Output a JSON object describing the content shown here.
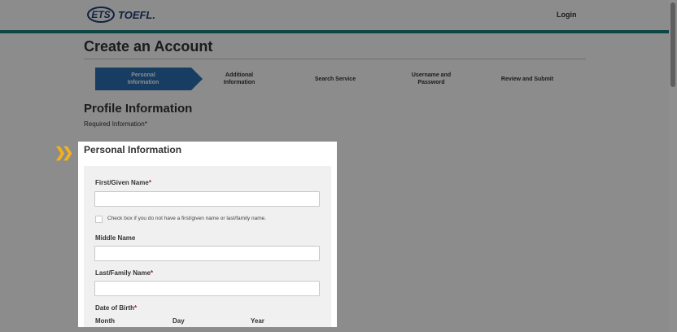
{
  "header": {
    "logo_ets": "ETS",
    "logo_toefl": "TOEFL.",
    "login_label": "Login"
  },
  "page": {
    "title": "Create an Account",
    "steps": [
      {
        "label": "Personal\nInformation",
        "active": true
      },
      {
        "label": "Additional\nInformation",
        "active": false
      },
      {
        "label": "Search Service",
        "active": false
      },
      {
        "label": "Username and\nPassword",
        "active": false
      },
      {
        "label": "Review and Submit",
        "active": false
      }
    ],
    "section_title": "Profile Information",
    "required_note": "Required Information*"
  },
  "personal_info": {
    "title": "Personal Information",
    "first_name_label": "First/Given Name",
    "first_name_value": "",
    "checkbox_label": "Check box if you do not have a first/given name or last/family name.",
    "middle_name_label": "Middle Name",
    "middle_name_value": "",
    "last_name_label": "Last/Family Name",
    "last_name_value": "",
    "dob_label": "Date of Birth",
    "dob_month_label": "Month",
    "dob_day_label": "Day",
    "dob_year_label": "Year",
    "required_mark": "*"
  },
  "colors": {
    "brand_teal": "#1b7f7e",
    "step_active": "#2a6fb5",
    "required": "#a31f2a",
    "highlight_chevron": "#f2b01e"
  },
  "icons": {
    "step_indicator": "double-chevron-right-icon"
  }
}
